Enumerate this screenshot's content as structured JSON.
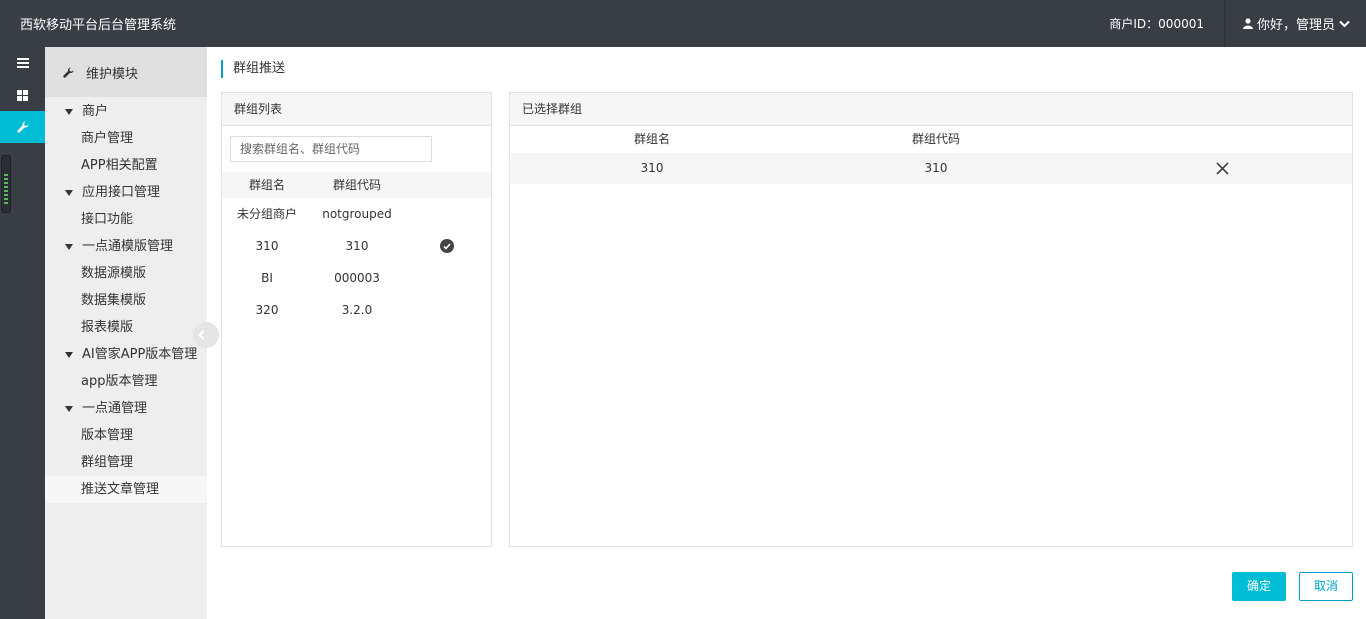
{
  "header": {
    "title": "西软移动平台后台管理系统",
    "merchant_label": "商户ID：000001",
    "user_label": "你好，管理员"
  },
  "rail": {
    "icons": [
      "menu-icon",
      "dashboard-icon",
      "wrench-icon"
    ]
  },
  "sidebar": {
    "module_title": "维护模块",
    "items": [
      {
        "type": "group",
        "label": "商户"
      },
      {
        "type": "sub",
        "label": "商户管理"
      },
      {
        "type": "sub",
        "label": "APP相关配置"
      },
      {
        "type": "group",
        "label": "应用接口管理"
      },
      {
        "type": "sub",
        "label": "接口功能"
      },
      {
        "type": "group",
        "label": "一点通模版管理"
      },
      {
        "type": "sub",
        "label": "数据源模版"
      },
      {
        "type": "sub",
        "label": "数据集模版"
      },
      {
        "type": "sub",
        "label": "报表模版"
      },
      {
        "type": "group",
        "label": "AI管家APP版本管理"
      },
      {
        "type": "sub",
        "label": "app版本管理"
      },
      {
        "type": "group",
        "label": "一点通管理"
      },
      {
        "type": "sub",
        "label": "版本管理"
      },
      {
        "type": "sub",
        "label": "群组管理"
      },
      {
        "type": "sub",
        "label": "推送文章管理",
        "active": true
      }
    ]
  },
  "main": {
    "page_title": "群组推送",
    "group_list": {
      "title": "群组列表",
      "search_placeholder": "搜索群组名、群组代码",
      "columns": [
        "群组名",
        "群组代码"
      ],
      "rows": [
        {
          "name": "未分组商户",
          "code": "notgrouped",
          "selected": false
        },
        {
          "name": "310",
          "code": "310",
          "selected": true
        },
        {
          "name": "BI",
          "code": "000003",
          "selected": false
        },
        {
          "name": "320",
          "code": "3.2.0",
          "selected": false
        }
      ]
    },
    "selected_groups": {
      "title": "已选择群组",
      "columns": [
        "群组名",
        "群组代码"
      ],
      "rows": [
        {
          "name": "310",
          "code": "310"
        }
      ]
    },
    "confirm_label": "确定",
    "cancel_label": "取消"
  },
  "colors": {
    "header_bg": "#393d44",
    "accent": "#00bcd4",
    "accent_border": "#00a2ca"
  }
}
